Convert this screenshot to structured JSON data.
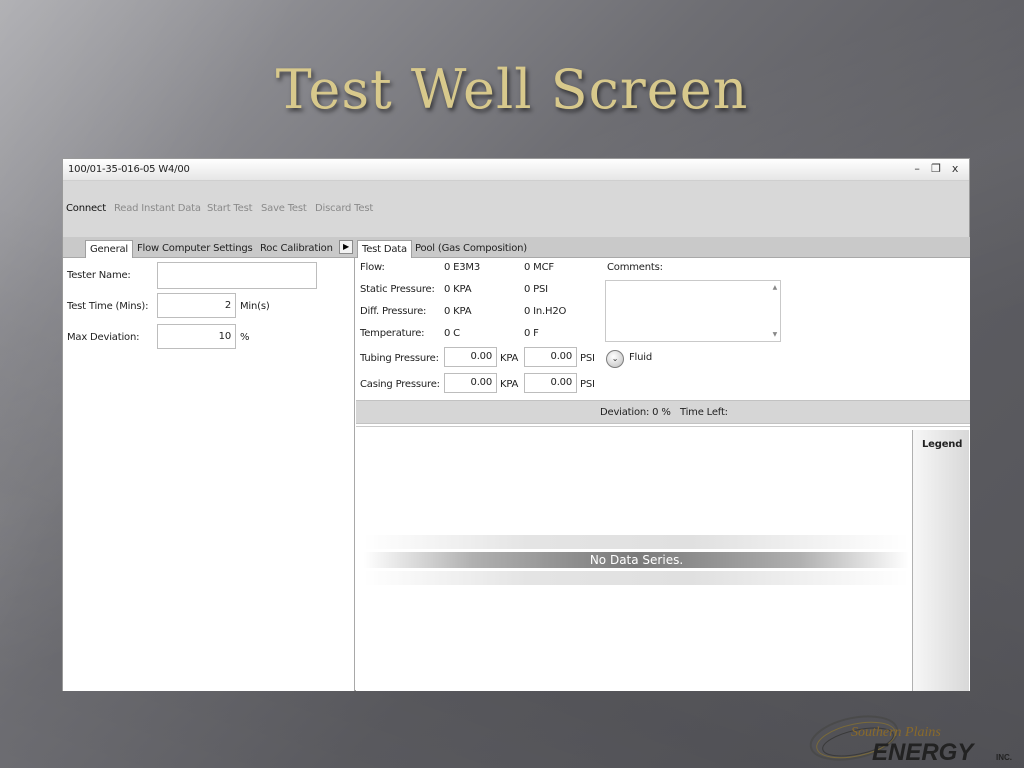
{
  "slide": {
    "title": "Test Well Screen"
  },
  "window": {
    "title": "100/01-35-016-05 W4/00",
    "controls": {
      "minimize": "–",
      "restore": "❐",
      "close": "x"
    }
  },
  "toolbar": {
    "connect": "Connect",
    "read_instant": "Read Instant Data",
    "start_test": "Start Test",
    "save_test": "Save Test",
    "discard_test": "Discard Test"
  },
  "left_tabs": {
    "general": "General",
    "flow_computer": "Flow Computer Settings",
    "roc_calibration": "Roc Calibration",
    "more_icon": "▶"
  },
  "general": {
    "tester_name_label": "Tester Name:",
    "tester_name_value": "",
    "test_time_label": "Test Time (Mins):",
    "test_time_value": "2",
    "test_time_unit": "Min(s)",
    "max_dev_label": "Max Deviation:",
    "max_dev_value": "10",
    "max_dev_unit": "%"
  },
  "right_tabs": {
    "test_data": "Test Data",
    "pool": "Pool (Gas Composition)"
  },
  "test_data": {
    "flow_label": "Flow:",
    "flow_si": "0 E3M3",
    "flow_imp": "0 MCF",
    "static_label": "Static Pressure:",
    "static_si": "0 KPA",
    "static_imp": "0 PSI",
    "diff_label": "Diff. Pressure:",
    "diff_si": "0 KPA",
    "diff_imp": "0 In.H2O",
    "temp_label": "Temperature:",
    "temp_si": "0 C",
    "temp_imp": "0 F",
    "tubing_label": "Tubing Pressure:",
    "tubing_kpa": "0.00",
    "tubing_psi": "0.00",
    "casing_label": "Casing Pressure:",
    "casing_kpa": "0.00",
    "casing_psi": "0.00",
    "unit_kpa": "KPA",
    "unit_psi": "PSI",
    "comments_label": "Comments:",
    "comments_value": "",
    "scroll_up": "▲",
    "scroll_down": "▼",
    "fluid_icon": "⌄",
    "fluid_label": "Fluid"
  },
  "status": {
    "deviation": "Deviation: 0 %",
    "time_left": "Time Left:"
  },
  "chart": {
    "no_data": "No Data Series.",
    "legend": "Legend"
  },
  "logo": {
    "line1": "Southern Plains",
    "line2": "ENERGY",
    "suffix": "INC."
  }
}
